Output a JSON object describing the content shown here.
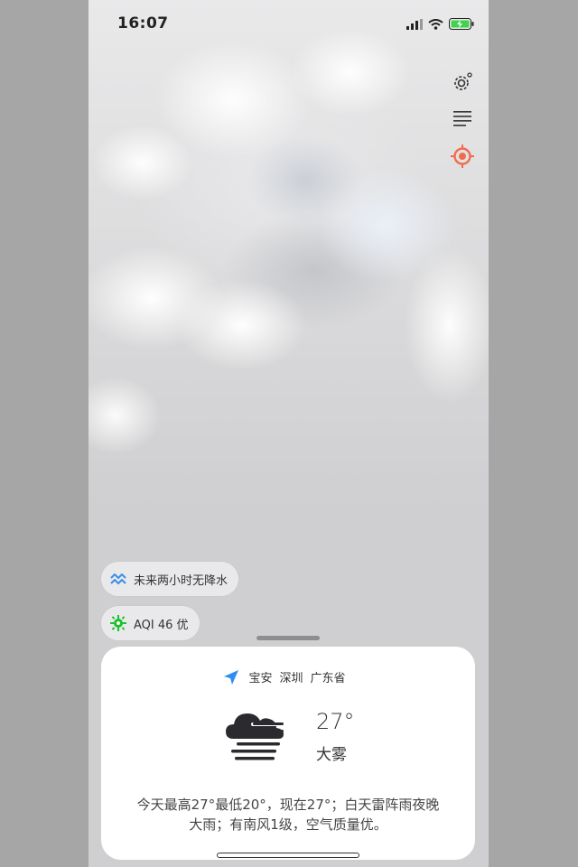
{
  "status_bar": {
    "time": "16:07"
  },
  "colors": {
    "accent_red": "#f26b4f",
    "nav_blue": "#2f8cf5",
    "aqi_green": "#19c12b",
    "rain_blue": "#3b8ee8",
    "battery_green": "#3fd34f"
  },
  "side_controls": {
    "settings_icon": "gear-icon",
    "list_icon": "list-icon",
    "locate_icon": "crosshair-icon"
  },
  "chips": {
    "rain_forecast": "未来两小时无降水",
    "aqi": "AQI 46 优"
  },
  "card": {
    "location": {
      "district": "宝安",
      "city": "深圳",
      "province": "广东省"
    },
    "temperature": "27°",
    "condition": "大雾",
    "condition_icon": "fog-icon",
    "summary": "今天最高27°最低20°，现在27°；白天雷阵雨夜晚大雨；有南风1级，空气质量优。"
  }
}
